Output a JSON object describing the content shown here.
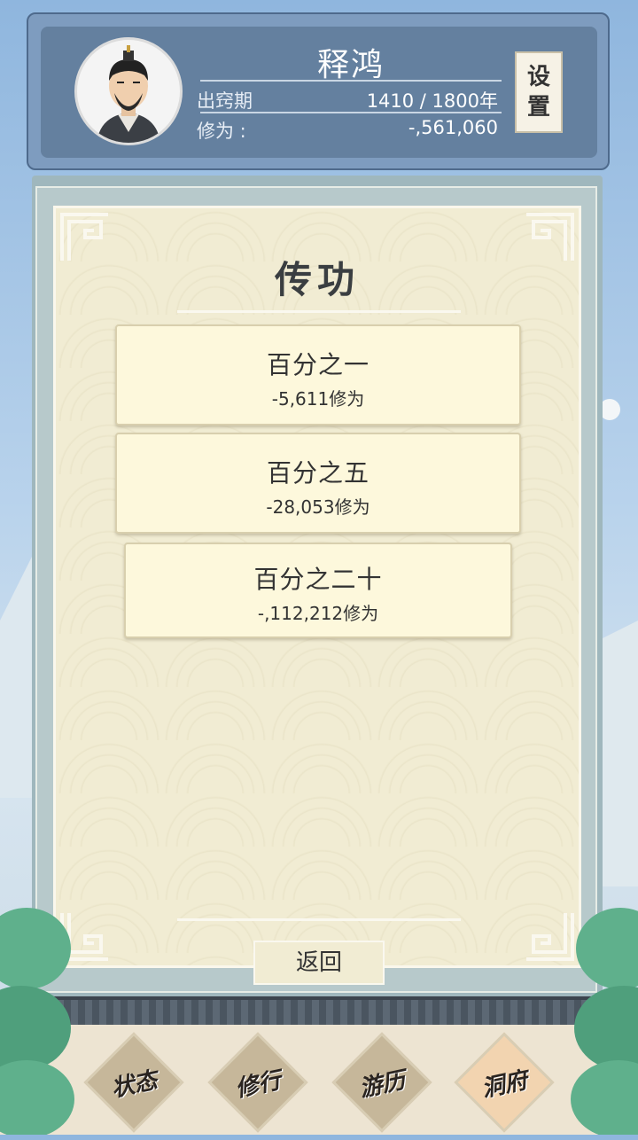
{
  "player": {
    "name": "释鸿",
    "stats": [
      {
        "label": "出窍期",
        "value": "1410 / 1800年"
      },
      {
        "label": "修为 :",
        "value": "-,561,060"
      }
    ],
    "settings_chars": [
      "设",
      "置"
    ]
  },
  "panel": {
    "title": "传功",
    "options": [
      {
        "title": "百分之一",
        "cost": "-5,611修为"
      },
      {
        "title": "百分之五",
        "cost": "-28,053修为"
      },
      {
        "title": "百分之二十",
        "cost": "-,112,212修为"
      }
    ],
    "back_label": "返回"
  },
  "nav": [
    {
      "label": "状态",
      "color": "#c6b79a"
    },
    {
      "label": "修行",
      "color": "#c6b79a"
    },
    {
      "label": "游历",
      "color": "#c6b79a"
    },
    {
      "label": "洞府",
      "color": "#f2d4b0"
    }
  ],
  "colors": {
    "header_bg": "#64809f",
    "paper": "#f1ecd3",
    "option_bg": "#fdf8dc",
    "text": "#333333"
  }
}
